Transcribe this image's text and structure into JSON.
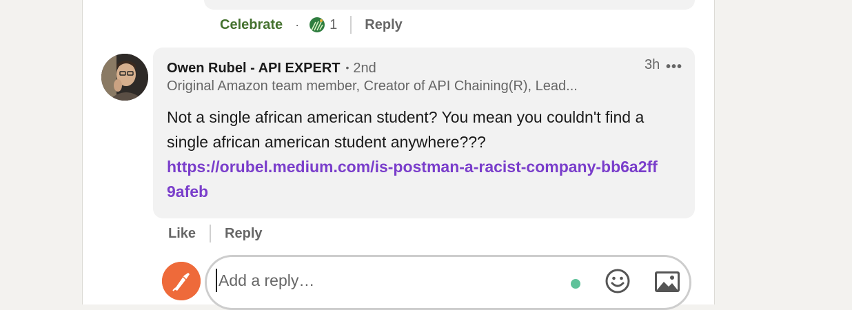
{
  "previous_comment": {
    "reaction_label": "Celebrate",
    "separator": "·",
    "reaction_count": "1",
    "reply_label": "Reply"
  },
  "comment": {
    "author": "Owen Rubel - API EXPERT",
    "degree_bullet": "•",
    "degree": "2nd",
    "headline": "Original Amazon team member, Creator of API Chaining(R), Lead...",
    "time": "3h",
    "more": "•••",
    "body": "Not a single african american student? You mean you couldn't find a single african american student anywhere???",
    "link": "https://orubel.medium.com/is-postman-a-racist-company-bb6a2ff9afeb",
    "like_label": "Like",
    "reply_label": "Reply"
  },
  "reply_box": {
    "placeholder": "Add a reply…"
  },
  "icons": {
    "reaction": "celebrate-reaction-icon",
    "more": "more-options-icon",
    "emoji": "emoji-icon",
    "image": "image-icon",
    "my_avatar": "postman-logo-avatar"
  },
  "colors": {
    "celebrate": "#44712e",
    "link": "#7a3ecb",
    "avatar_brand": "#ee6a3a",
    "online": "#5fc29a"
  }
}
